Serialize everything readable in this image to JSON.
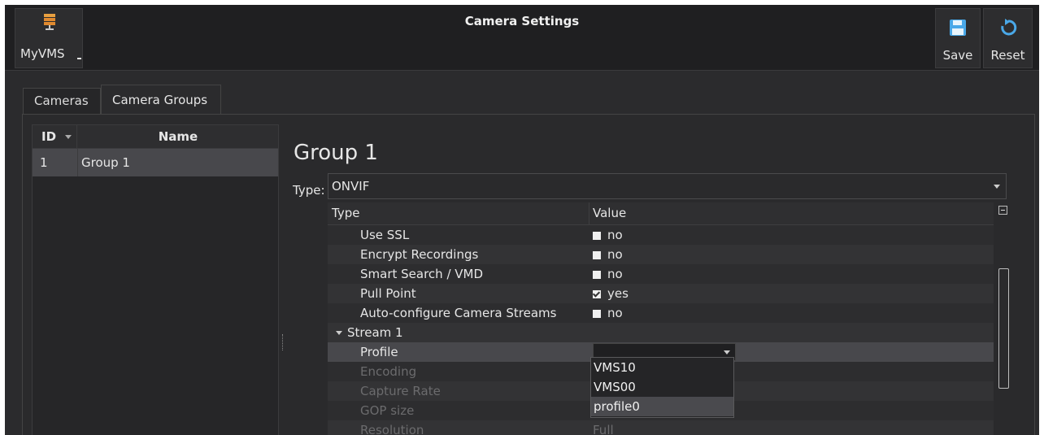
{
  "app": {
    "name": "MyVMS"
  },
  "window": {
    "title": "Camera Settings"
  },
  "toolbar": {
    "save_label": "Save",
    "reset_label": "Reset"
  },
  "tabs": [
    {
      "label": "Cameras",
      "active": false
    },
    {
      "label": "Camera Groups",
      "active": true
    }
  ],
  "group_list": {
    "headers": {
      "id": "ID",
      "name": "Name"
    },
    "rows": [
      {
        "id": "1",
        "name": "Group 1"
      }
    ]
  },
  "group": {
    "title": "Group 1",
    "type_label": "Type:",
    "type_value": "ONVIF"
  },
  "properties": {
    "headers": {
      "type": "Type",
      "value": "Value"
    },
    "rows": [
      {
        "key": "Use SSL",
        "value": "no",
        "checked": false
      },
      {
        "key": "Encrypt Recordings",
        "value": "no",
        "checked": false
      },
      {
        "key": "Smart Search / VMD",
        "value": "no",
        "checked": false
      },
      {
        "key": "Pull Point",
        "value": "yes",
        "checked": true
      },
      {
        "key": "Auto-configure Camera Streams",
        "value": "no",
        "checked": false
      }
    ],
    "section": "Stream 1",
    "stream_rows": [
      {
        "key": "Profile",
        "value": ""
      },
      {
        "key": "Encoding",
        "value": ""
      },
      {
        "key": "Capture Rate",
        "value": ""
      },
      {
        "key": "GOP size",
        "value": ""
      },
      {
        "key": "Resolution",
        "value": "Full"
      }
    ]
  },
  "profile_dropdown": {
    "options": [
      "VMS10",
      "VMS00",
      "profile0"
    ],
    "highlighted": "profile0"
  },
  "colors": {
    "background": "#2b2b2d",
    "selection": "#48484c",
    "disabled_text": "#6b6b6d"
  }
}
